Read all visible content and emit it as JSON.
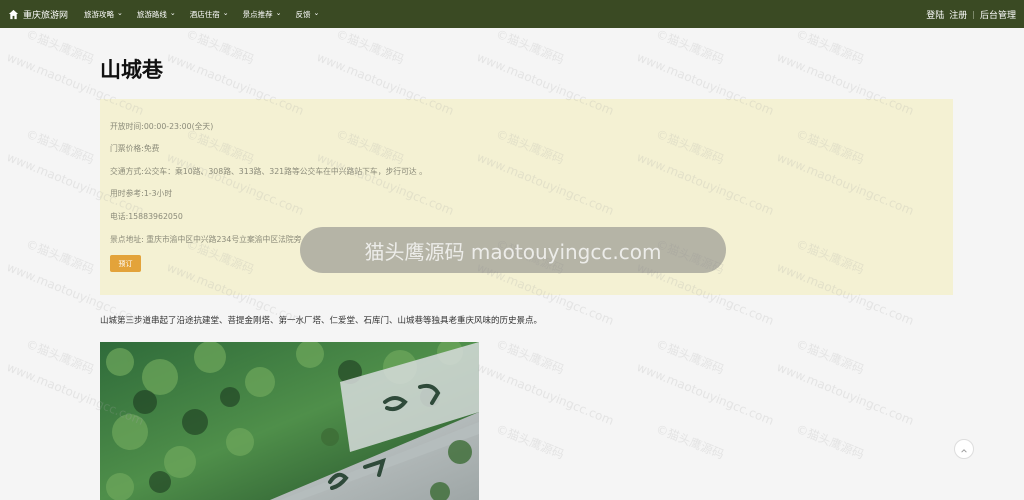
{
  "site": {
    "brand": "重庆旅游网",
    "nav": [
      {
        "label": "旅游攻略"
      },
      {
        "label": "旅游路线"
      },
      {
        "label": "酒店住宿"
      },
      {
        "label": "景点推荐"
      },
      {
        "label": "反馈"
      }
    ],
    "auth": {
      "login": "登陆",
      "register": "注册",
      "separator": "|",
      "admin": "后台管理"
    }
  },
  "page": {
    "title": "山城巷",
    "info": {
      "hours": "开放时间:00:00-23:00(全天)",
      "ticket": "门票价格:免费",
      "transport": "交通方式:公交车：乘10路、308路、313路、321路等公交车在中兴路站下车，步行可达 。",
      "duration": "用时参考:1-3小时",
      "phone": "电话:15883962050",
      "address": "景点地址: 重庆市渝中区中兴路234号立案渝中区法院旁"
    },
    "book_button": "预订",
    "description": "山城第三步道串起了沿途抗建堂、菩提金刚塔、第一水厂塔、仁爱堂、石库门、山城巷等独具老重庆风味的历史景点。"
  },
  "watermark": {
    "banner": "猫头鹰源码 maotouyingcc.com",
    "tile_1": "©猫头鹰源码",
    "tile_2": "www.maotouyingcc.com"
  },
  "icons": {
    "home": "home-icon",
    "chevron": "chevron-down-icon",
    "scroll_top": "arrow-up-icon"
  }
}
